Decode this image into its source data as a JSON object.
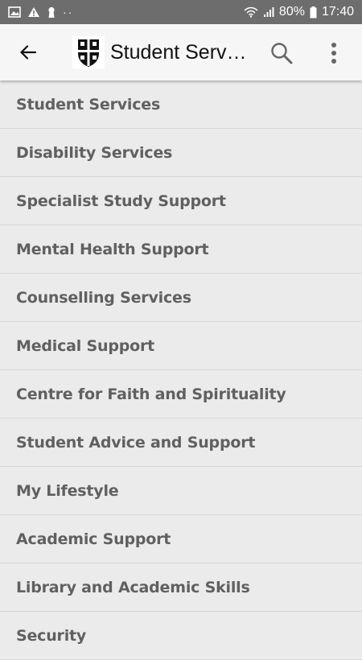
{
  "status_bar": {
    "icons_left": [
      "image-icon",
      "warning-icon",
      "keyhole-icon",
      "dots-icon"
    ],
    "battery_percent": "80%",
    "time": "17:40",
    "icons_right": [
      "wifi-icon",
      "signal-icon",
      "battery-icon"
    ]
  },
  "app_bar": {
    "title": "Student Services",
    "back_icon": "back-arrow-icon",
    "logo": "university-crest",
    "search_icon": "search-icon",
    "more_icon": "more-vert-icon"
  },
  "items": [
    {
      "label": "Student Services"
    },
    {
      "label": "Disability Services"
    },
    {
      "label": "Specialist Study Support"
    },
    {
      "label": "Mental Health Support"
    },
    {
      "label": "Counselling Services"
    },
    {
      "label": "Medical Support"
    },
    {
      "label": "Centre for Faith and Spirituality"
    },
    {
      "label": "Student Advice and Support"
    },
    {
      "label": "My Lifestyle"
    },
    {
      "label": "Academic Support"
    },
    {
      "label": "Library and Academic Skills"
    },
    {
      "label": "Security"
    }
  ],
  "colors": {
    "status_bar": "#6d6d6d",
    "app_bar": "#f6f6f6",
    "list_background": "#ebebeb",
    "item_text": "#606060",
    "divider": "#d6d6d6"
  }
}
